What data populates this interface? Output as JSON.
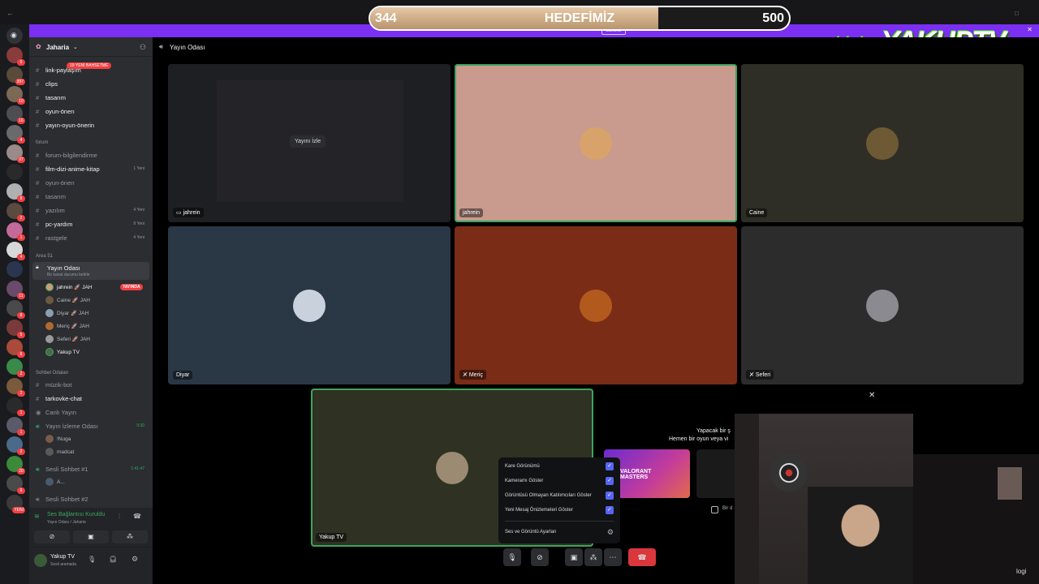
{
  "goal": {
    "current": "344",
    "title": "HEDEFİMİZ",
    "max": "500",
    "progress_fraction": 0.688
  },
  "logo": {
    "kick": "kick",
    "brand": "YAKUPTV"
  },
  "banner": {
    "button": "Güncelle"
  },
  "server": {
    "name": "Jaharia"
  },
  "new_badge": "19 YENİ BAHSETME",
  "channels": [
    {
      "name": "link-paylaşım",
      "bright": true
    },
    {
      "name": "clips",
      "bright": true
    },
    {
      "name": "tasarım",
      "bright": true
    },
    {
      "name": "oyun-önerı",
      "bright": true
    },
    {
      "name": "yayın-oyun-önerin",
      "bright": true
    }
  ],
  "forum_category": "forum",
  "forum_channels": [
    {
      "name": "forum-bilgilendirme",
      "new": ""
    },
    {
      "name": "film-dizi-anime-kitap",
      "new": "1 Yeni",
      "bright": true
    },
    {
      "name": "oyun-önerı",
      "new": ""
    },
    {
      "name": "tasarım",
      "new": ""
    },
    {
      "name": "yazılım",
      "new": "4 Yeni"
    },
    {
      "name": "pc-yardım",
      "new": "9 Yeni",
      "bright": true
    },
    {
      "name": "rastgele",
      "new": "4 Yeni"
    }
  ],
  "area_category": "Area 51",
  "voice_room": {
    "name": "Yayın Odası",
    "status": "Bir kanal durumu belirle"
  },
  "live_badge": "YAYINDA",
  "voice_users": [
    {
      "name": "jahrein",
      "tag": "JAH"
    },
    {
      "name": "Caine",
      "tag": "JAH"
    },
    {
      "name": "Diyar",
      "tag": "JAH"
    },
    {
      "name": "Meriç",
      "tag": "JAH"
    },
    {
      "name": "Seferi",
      "tag": "JAH"
    },
    {
      "name": "Yakup TV",
      "tag": ""
    }
  ],
  "chat_category": "Sohbet Odaları",
  "chat_channels": [
    {
      "name": "müzik-bot",
      "extra": ""
    },
    {
      "name": "tarkovke-chat",
      "extra": ""
    },
    {
      "name": "Canlı Yayın",
      "extra": ""
    },
    {
      "name": "Yayın İzleme Odası",
      "extra": "9:30"
    }
  ],
  "watch_users": [
    "!Nuga",
    "madcat"
  ],
  "sesli1": {
    "name": "Sesli Sohbet #1",
    "time": "1:41:47",
    "user": "A..."
  },
  "sesli2": "Sesli Sohbet #2",
  "connection": {
    "status": "Ses Bağlantısı Kuruldu",
    "location": "Yayın Odası / Jaharia"
  },
  "me": {
    "name": "Yakup TV",
    "status": "Sesli aramada"
  },
  "main_title": "Yayın Odası",
  "tiles": {
    "t1": {
      "name": "jahrein",
      "overlay": "Yayını İzle"
    },
    "t2": {
      "name": "jahrein"
    },
    "t3": {
      "name": "Caine"
    },
    "t4": {
      "name": "Diyar"
    },
    "t5": {
      "name": "Meriç"
    },
    "t6": {
      "name": "Seferi"
    },
    "t7": {
      "name": "Yakup TV"
    }
  },
  "menu": {
    "items": [
      "Kare Görünümü",
      "Kameramı Göster",
      "Görüntüsü Olmayan Katılımcıları Göster",
      "Yeni Mesaj Önizlemeleri Göster"
    ],
    "settings": "Ses ve Görüntü Ayarları"
  },
  "activity": {
    "line1": "Yapacak bir ş",
    "line2": "Hemen bir oyun veya vi",
    "card": "VALORANT MASTERS",
    "checkbox": "Bir d"
  },
  "corner_text": "logi",
  "colors": {
    "accent": "#5865f2",
    "danger": "#da373c",
    "speaking": "#3ba55d",
    "banner": "#7b2ff2"
  }
}
